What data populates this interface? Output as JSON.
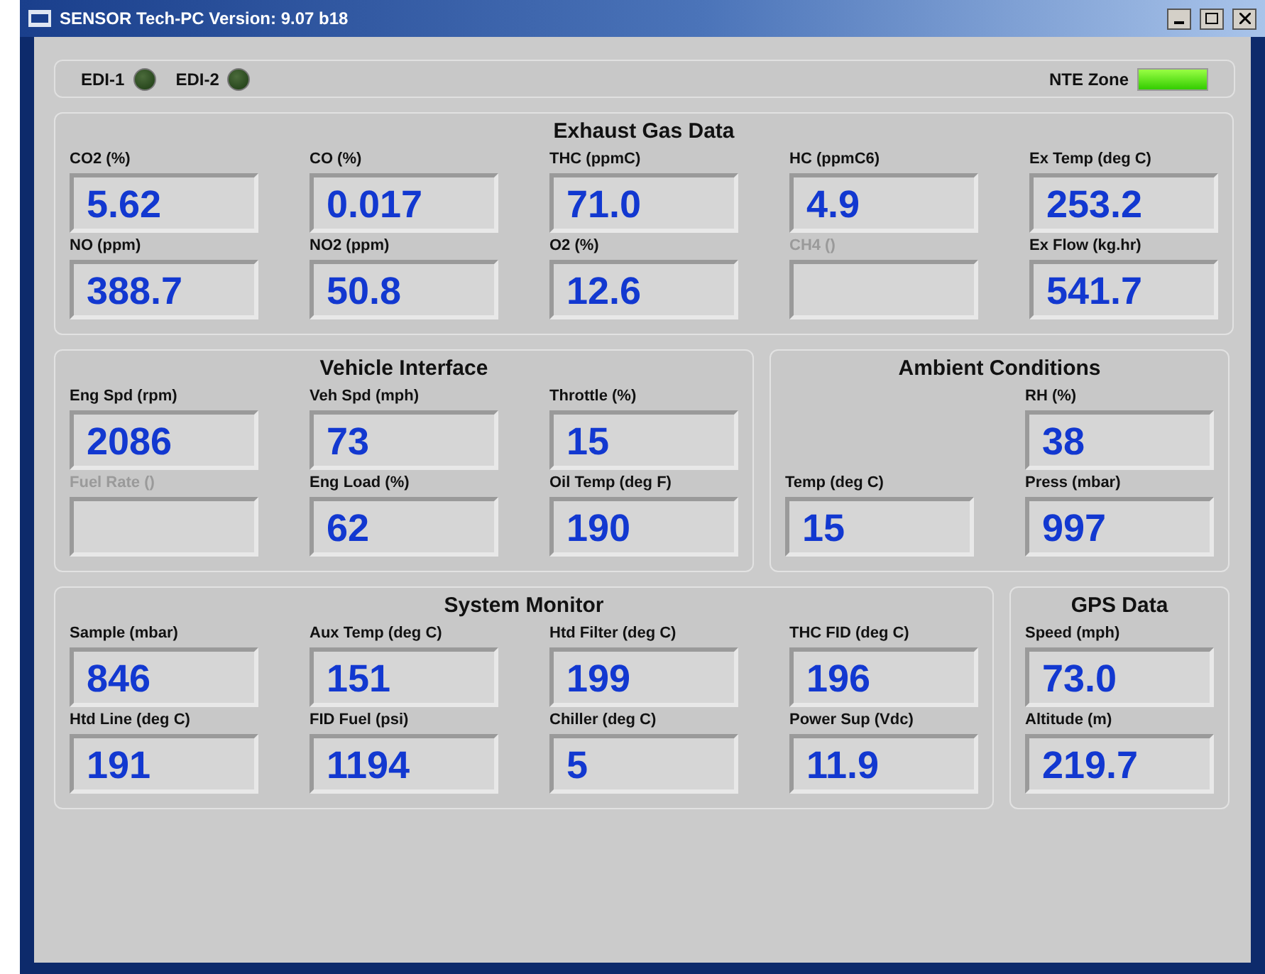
{
  "window": {
    "title": "SENSOR Tech-PC Version: 9.07 b18"
  },
  "indicators": [
    {
      "label": "EDI-1",
      "kind": "led",
      "on": false
    },
    {
      "label": "EDI-2",
      "kind": "led",
      "on": false
    },
    {
      "label": "NTE Zone",
      "kind": "bar",
      "on": true
    }
  ],
  "rows": [
    [
      {
        "title": "Exhaust Gas Data",
        "rows": [
          [
            {
              "label": "CO2 (%)",
              "value": "5.62",
              "disabled": false
            },
            {
              "label": "CO (%)",
              "value": "0.017",
              "disabled": false
            },
            {
              "label": "THC (ppmC)",
              "value": "71.0",
              "disabled": false
            },
            {
              "label": "HC (ppmC6)",
              "value": "4.9",
              "disabled": false
            },
            {
              "label": "Ex Temp (deg C)",
              "value": "253.2",
              "disabled": false
            }
          ],
          [
            {
              "label": "NO (ppm)",
              "value": "388.7",
              "disabled": false
            },
            {
              "label": "NO2 (ppm)",
              "value": "50.8",
              "disabled": false
            },
            {
              "label": "O2 (%)",
              "value": "12.6",
              "disabled": false
            },
            {
              "label": "CH4 ()",
              "disabled": true
            },
            {
              "label": "Ex Flow (kg.hr)",
              "value": "541.7",
              "disabled": false
            }
          ]
        ]
      }
    ],
    [
      {
        "title": "Vehicle Interface",
        "rows": [
          [
            {
              "label": "Eng Spd (rpm)",
              "value": "2086",
              "disabled": false
            },
            {
              "label": "Veh Spd (mph)",
              "value": "73",
              "disabled": false
            },
            {
              "label": "Throttle (%)",
              "value": "15",
              "disabled": false
            }
          ],
          [
            {
              "label": "Fuel Rate ()",
              "disabled": true
            },
            {
              "label": "Eng Load (%)",
              "value": "62",
              "disabled": false
            },
            {
              "label": "Oil Temp (deg F)",
              "value": "190",
              "disabled": false
            }
          ]
        ]
      },
      {
        "title": "Ambient Conditions",
        "rows": [
          [
            "",
            {
              "label": "RH (%)",
              "value": "38",
              "disabled": false
            }
          ],
          [
            {
              "label": "Temp (deg C)",
              "value": "15",
              "disabled": false
            },
            {
              "label": "Press (mbar)",
              "value": "997",
              "disabled": false
            }
          ]
        ]
      }
    ],
    [
      {
        "title": "System Monitor",
        "rows": [
          [
            {
              "label": "Sample (mbar)",
              "value": "846",
              "disabled": false
            },
            {
              "label": "Aux Temp (deg C)",
              "value": "151",
              "disabled": false
            },
            {
              "label": "Htd Filter (deg C)",
              "value": "199",
              "disabled": false
            },
            {
              "label": "THC FID (deg C)",
              "value": "196",
              "disabled": false
            }
          ],
          [
            {
              "label": "Htd Line (deg C)",
              "value": "191",
              "disabled": false
            },
            {
              "label": "FID Fuel (psi)",
              "value": "1194",
              "disabled": false
            },
            {
              "label": "Chiller (deg C)",
              "value": "5",
              "disabled": false
            },
            {
              "label": "Power Sup (Vdc)",
              "value": "11.9",
              "disabled": false
            }
          ]
        ]
      },
      {
        "title": "GPS Data",
        "rows": [
          [
            {
              "label": "Speed (mph)",
              "value": "73.0",
              "disabled": false
            }
          ],
          [
            {
              "label": "Altitude (m)",
              "value": "219.7",
              "disabled": false
            }
          ]
        ]
      }
    ]
  ]
}
